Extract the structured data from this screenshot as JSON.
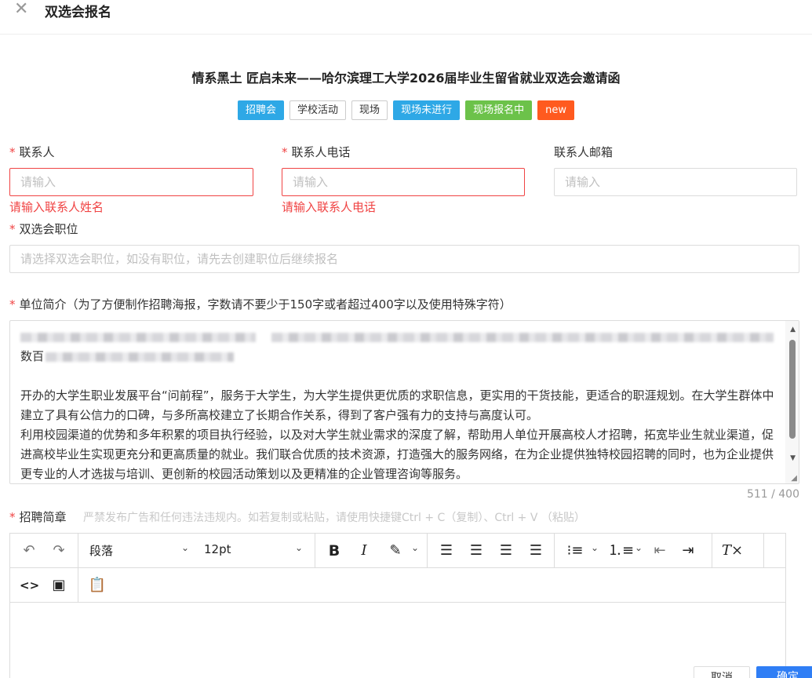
{
  "drawer": {
    "title": "双选会报名",
    "close_icon": "close-icon"
  },
  "event": {
    "title": "情系黑土 匠启未来——哈尔滨理工大学2026届毕业生留省就业双选会邀请函",
    "tags": [
      {
        "label": "招聘会",
        "color": "#2ea8e6"
      },
      {
        "label": "学校活动",
        "color": "#ffffff"
      },
      {
        "label": "现场",
        "color": "#ffffff"
      },
      {
        "label": "现场未进行",
        "color": "#2ea8e6"
      },
      {
        "label": "现场报名中",
        "color": "#6cc24a"
      },
      {
        "label": "new",
        "color": "#ff5a1f"
      }
    ]
  },
  "form": {
    "contact_name": {
      "label": "联系人",
      "placeholder": "请输入",
      "error": "请输入联系人姓名"
    },
    "contact_phone": {
      "label": "联系人电话",
      "placeholder": "请输入",
      "error": "请输入联系人电话"
    },
    "contact_email": {
      "label": "联系人邮箱",
      "placeholder": "请输入"
    },
    "position": {
      "label": "双选会职位",
      "placeholder": "请选择双选会职位，如没有职位，请先去创建职位后继续报名"
    },
    "intro": {
      "label": "单位简介（为了方便制作招聘海报，字数请不要少于150字或者超过400字以及使用特殊字符）",
      "line2_prefix": "数百",
      "paragraph1": "开办的大学生职业发展平台“问前程”，服务于大学生，为大学生提供更优质的求职信息，更实用的干货技能，更适合的职涯规划。在大学生群体中建立了具有公信力的口碑，与多所高校建立了长期合作关系，得到了客户强有力的支持与高度认可。",
      "paragraph2": "利用校园渠道的优势和多年积累的项目执行经验，以及对大学生就业需求的深度了解，帮助用人单位开展高校人才招聘，拓宽毕业生就业渠道，促进高校毕业生实现更充分和更高质量的就业。我们联合优质的技术资源，打造强大的服务网络，在为企业提供独特校园招聘的同时，也为企业提供更专业的人才选拔与培训、更创新的校园活动策划以及更精准的企业管理咨询等服务。",
      "counter": "511 / 400"
    },
    "brochure": {
      "label": "招聘简章",
      "hint": "严禁发布广告和任何违法违规内。如若复制或粘贴，请使用快捷键Ctrl + C（复制）、Ctrl + V （粘贴）"
    }
  },
  "editor_toolbar": {
    "paragraph": "段落",
    "font_size": "12pt",
    "bold": "B",
    "italic": "I"
  },
  "footer": {
    "cancel": "取消",
    "submit": "确定"
  }
}
